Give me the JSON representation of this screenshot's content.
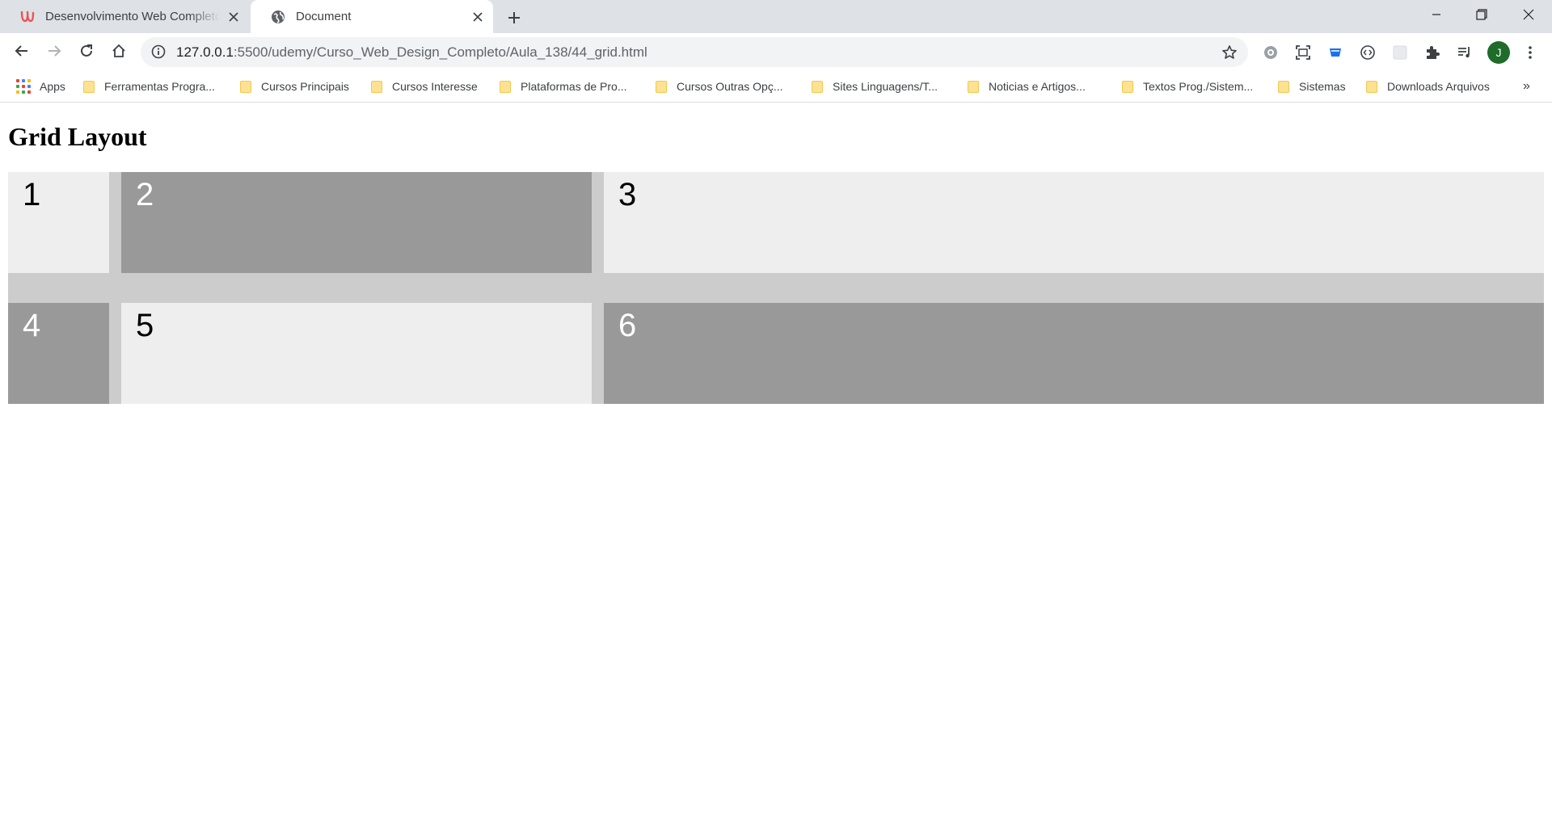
{
  "browser": {
    "tabs": [
      {
        "title": "Desenvolvimento Web Completo",
        "active": false,
        "favicon": "udemy-icon"
      },
      {
        "title": "Document",
        "active": true,
        "favicon": "globe-icon"
      }
    ],
    "address": {
      "host": "127.0.0.1",
      "path": ":5500/udemy/Curso_Web_Design_Completo/Aula_138/44_grid.html"
    },
    "profile_initial": "J",
    "bookmarks": [
      "Apps",
      "Ferramentas Progra...",
      "Cursos Principais",
      "Cursos Interesse",
      "Plataformas de Pro...",
      "Cursos Outras Opç...",
      "Sites Linguagens/T...",
      "Noticias e Artigos...",
      "Textos Prog./Sistem...",
      "Sistemas",
      "Downloads Arquivos"
    ],
    "bookmarks_overflow": "»"
  },
  "page": {
    "heading": "Grid Layout",
    "cells": [
      "1",
      "2",
      "3",
      "4",
      "5",
      "6"
    ]
  },
  "colors": {
    "grid_background": "#cccccc",
    "cell_light": "#eeeeee",
    "cell_dark": "#999999",
    "tabstrip": "#dee1e6",
    "avatar": "#1e6b2a"
  }
}
